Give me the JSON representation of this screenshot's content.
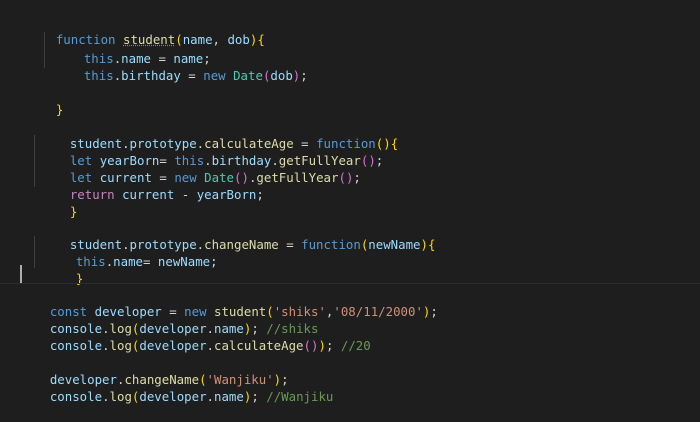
{
  "code": {
    "l01": {
      "kw": "function",
      "fn": "student",
      "p1": "(",
      "a1": "name",
      "c1": ", ",
      "a2": "dob",
      "p2": ")",
      "b": "{"
    },
    "l02": {
      "t": "this",
      "d": ".",
      "p": "name",
      "eq": " = ",
      "v": "name",
      "s": ";"
    },
    "l03": {
      "t": "this",
      "d": ".",
      "p": "birthday",
      "eq": " = ",
      "n": "new",
      "sp": " ",
      "c": "Date",
      "o": "(",
      "v": "dob",
      "cl": ")",
      "s": ";"
    },
    "l05": {
      "b": "}"
    },
    "l07": {
      "o": "student",
      "d1": ".",
      "p1": "prototype",
      "d2": ".",
      "p2": "calculateAge",
      "eq": " = ",
      "kw": "function",
      "po": "(",
      "pc": ")",
      "b": "{"
    },
    "l08": {
      "kw": "let",
      "sp": " ",
      "v": "yearBorn",
      "eq": "= ",
      "t": "this",
      "d1": ".",
      "p": "birthday",
      "d2": ".",
      "m": "getFullYear",
      "po": "(",
      "pc": ")",
      "s": ";"
    },
    "l09": {
      "kw": "let",
      "sp": " ",
      "v": "current",
      "eq": " = ",
      "n": "new",
      "sp2": " ",
      "c": "Date",
      "po": "(",
      "pc": ")",
      "d": ".",
      "m": "getFullYear",
      "po2": "(",
      "pc2": ")",
      "s": ";"
    },
    "l10": {
      "kw": "return",
      "sp": " ",
      "v1": "current",
      "op": " - ",
      "v2": "yearBorn",
      "s": ";"
    },
    "l11": {
      "b": "}"
    },
    "l13": {
      "o": "student",
      "d1": ".",
      "p1": "prototype",
      "d2": ".",
      "p2": "changeName",
      "eq": " = ",
      "kw": "function",
      "po": "(",
      "a": "newName",
      "pc": ")",
      "b": "{"
    },
    "l14": {
      "t": "this",
      "d": ".",
      "p": "name",
      "eq": "= ",
      "v": "newName",
      "s": ";"
    },
    "l15": {
      "b": "}"
    },
    "l17": {
      "kw": "const",
      "sp": " ",
      "v": "developer",
      "eq": " = ",
      "n": "new",
      "sp2": " ",
      "f": "student",
      "po": "(",
      "s1": "'shiks'",
      "c": ",",
      "s2": "'08/11/2000'",
      "pc": ")",
      "s": ";"
    },
    "l18": {
      "o": "console",
      "d1": ".",
      "m": "log",
      "po": "(",
      "v": "developer",
      "d2": ".",
      "p": "name",
      "pc": ")",
      "s": "; ",
      "cm": "//shiks"
    },
    "l19": {
      "o": "console",
      "d1": ".",
      "m": "log",
      "po": "(",
      "v": "developer",
      "d2": ".",
      "f": "calculateAge",
      "po2": "(",
      "pc2": ")",
      "pc": ")",
      "s": "; ",
      "cm": "//20"
    },
    "l21": {
      "v": "developer",
      "d": ".",
      "f": "changeName",
      "po": "(",
      "s1": "'Wanjiku'",
      "pc": ")",
      "s": ";"
    },
    "l22": {
      "o": "console",
      "d1": ".",
      "m": "log",
      "po": "(",
      "v": "developer",
      "d2": ".",
      "p": "name",
      "pc": ")",
      "s": "; ",
      "cm": "//Wanjiku"
    }
  },
  "colors": {
    "background": "#1e1e1e",
    "keyword": "#569cd6",
    "function": "#dcdcaa",
    "variable": "#9cdcfe",
    "string": "#ce9178",
    "comment": "#6a9955",
    "class": "#4ec9b0"
  }
}
